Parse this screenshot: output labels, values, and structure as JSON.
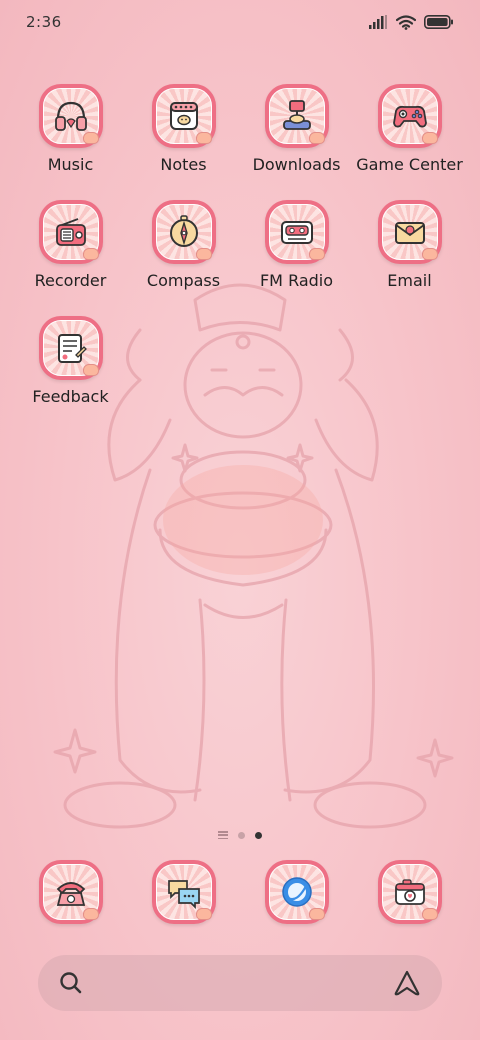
{
  "status_bar": {
    "time": "2:36",
    "icons": [
      "signal-icon",
      "wifi-icon",
      "battery-icon"
    ]
  },
  "apps": [
    {
      "label": "Music",
      "icon": "headphones-icon"
    },
    {
      "label": "Notes",
      "icon": "notepad-icon"
    },
    {
      "label": "Downloads",
      "icon": "download-box-icon"
    },
    {
      "label": "Game Center",
      "icon": "gamepad-icon"
    },
    {
      "label": "Recorder",
      "icon": "radio-recorder-icon"
    },
    {
      "label": "Compass",
      "icon": "compass-icon"
    },
    {
      "label": "FM Radio",
      "icon": "cassette-icon"
    },
    {
      "label": "Email",
      "icon": "envelope-icon"
    },
    {
      "label": "Feedback",
      "icon": "feedback-paper-icon"
    }
  ],
  "dock": [
    {
      "icon": "telephone-icon"
    },
    {
      "icon": "chat-bubbles-icon"
    },
    {
      "icon": "browser-globe-icon"
    },
    {
      "icon": "camera-icon"
    }
  ],
  "page_indicator": {
    "pages": 2,
    "active": 1
  },
  "colors": {
    "background": "#f8c9cf",
    "icon_border": "#ee6f85",
    "text": "#222222"
  }
}
